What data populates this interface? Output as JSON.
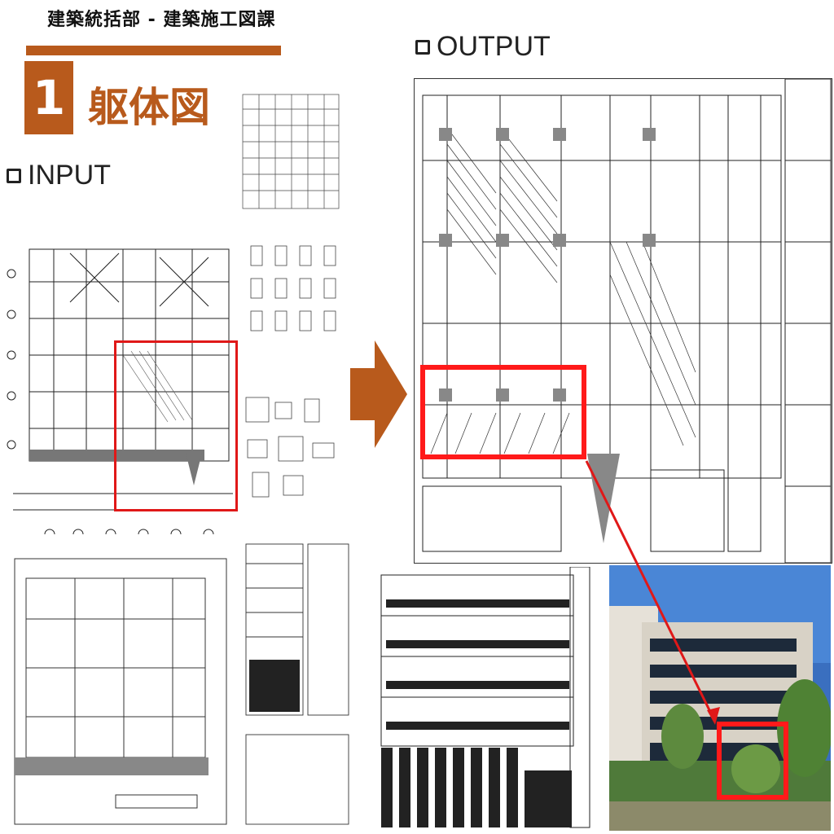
{
  "header": {
    "dept_title": "建築統括部 - 建築施工図課",
    "section_number": "1",
    "section_title": "躯体図"
  },
  "labels": {
    "input": "INPUT",
    "output": "OUTPUT"
  },
  "colors": {
    "accent": "#b85a1c",
    "highlight": "#e01818"
  },
  "icons": {
    "input_checkbox": "checkbox-icon",
    "output_checkbox": "checkbox-icon",
    "arrow": "right-arrow-icon"
  }
}
